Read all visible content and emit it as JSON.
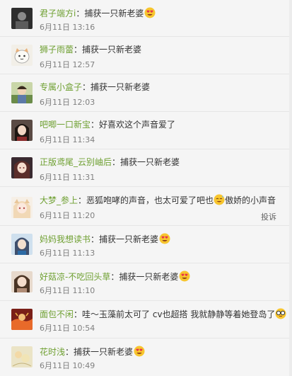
{
  "comments": [
    {
      "username": "君子端方i",
      "text": "捕获一只新老婆",
      "time": "6月11日 13:16",
      "emoji": "heart-eyes"
    },
    {
      "username": "狮子雨蕾",
      "text": "捕获一只新老婆",
      "time": "6月11日 12:57",
      "emoji": ""
    },
    {
      "username": "专属小盒子",
      "text": "捕获一只新老婆",
      "time": "6月11日 12:03",
      "emoji": ""
    },
    {
      "username": "吧唧一口新宝",
      "text": "好喜欢这个声音爱了",
      "time": "6月11日 11:34",
      "emoji": ""
    },
    {
      "username": "正版鸢尾_云别岫后",
      "text": "捕获一只新老婆",
      "time": "6月11日 11:31",
      "emoji": ""
    },
    {
      "username": "大梦_参上",
      "text": "恶狐咆哮的声音，也太可爱了吧也",
      "text2": "傲娇的小声音",
      "time": "6月11日 11:20",
      "emoji": "sweat-smile",
      "report": "投诉"
    },
    {
      "username": "妈妈我想读书",
      "text": "捕获一只新老婆",
      "time": "6月11日 11:13",
      "emoji": "heart-eyes"
    },
    {
      "username": "好菇凉-不吃回头草",
      "text": "捕获一只新老婆",
      "time": "6月11日 11:10",
      "emoji": "heart-eyes"
    },
    {
      "username": "面包不闲",
      "text": "哇～玉藻前太可了 cv也超搭 我就静静等着她登岛了",
      "time": "6月11日 10:54",
      "emoji": "glasses"
    },
    {
      "username": "花时浅",
      "text": "捕获一只新老婆",
      "time": "6月11日 10:49",
      "emoji": "heart-eyes"
    }
  ],
  "separator": "：",
  "colors": {
    "username": "#6fa032",
    "text": "#333333",
    "time": "#808080",
    "background": "#f5f5f5"
  }
}
